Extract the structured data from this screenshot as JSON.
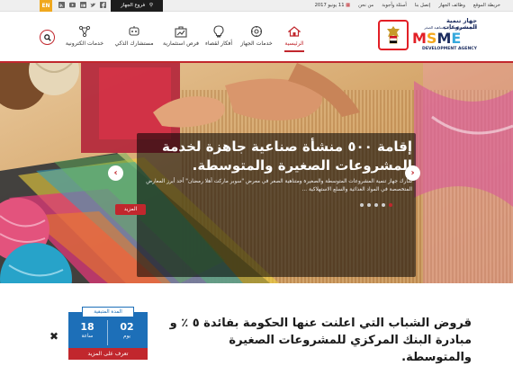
{
  "topbar": {
    "language": "EN",
    "social_icons": [
      "rss-icon",
      "youtube-icon",
      "linkedin-icon",
      "twitter-icon",
      "facebook-icon",
      "instagram-icon"
    ],
    "branches_label": "فروع الجهاز",
    "date": "11 يونيو 2017",
    "links": [
      "من نحن",
      "أسئلة وأجوبة",
      "إتصل بنا",
      "وظائف الجهاز",
      "خريطة الموقع"
    ]
  },
  "header": {
    "logo_ar_title": "جهاز تنمية المشروعات",
    "logo_ar_sub": "المتوسطة والصغيرة ومتناهية الصغر",
    "logo_msme": "MSME",
    "logo_agency": "DEVELOPMENT AGENCY",
    "nav": [
      {
        "label": "الرئيسية",
        "icon": "home-icon",
        "active": true
      },
      {
        "label": "خدمات الجهاز",
        "icon": "services-icon",
        "active": false
      },
      {
        "label": "أفكار لقصاء",
        "icon": "lightbulb-icon",
        "active": false
      },
      {
        "label": "فرص استثمارية",
        "icon": "investment-icon",
        "active": false
      },
      {
        "label": "مستشارك الذكي",
        "icon": "advisor-icon",
        "active": false
      },
      {
        "label": "خدمات الكترونية",
        "icon": "eservices-icon",
        "active": false
      }
    ],
    "search_icon": "search-icon"
  },
  "hero": {
    "title": "إقامة ٥٠٠ منشأة صناعية جاهزة لخدمة المشروعات الصغيرة والمتوسطة.",
    "description": "شارك جهاز تنمية المشروعات المتوسطة والصغيرة ومتناهية الصغر في معرض \"سوبر ماركت أهلا رمضان\" أحد أبرز المعارض المتخصصة في المواد الغذائية والسلع الاستهلاكية ...",
    "more_label": "المزيد",
    "slides_count": 5,
    "active_slide": 4,
    "colors": {
      "accent": "#c1272d"
    }
  },
  "news": {
    "text": "قروض الشباب التي اعلنت عنها الحكومة بفائدة ٥ ٪ و مبادرة البنك المركزي للمشروعات الصغيرة والمتوسطة.",
    "countdown_title": "المدة المتبقية",
    "days_value": "02",
    "days_unit": "يوم",
    "hours_value": "18",
    "hours_unit": "ساعة",
    "know_more": "تعرف على المزيد",
    "close_icon": "close-icon"
  }
}
